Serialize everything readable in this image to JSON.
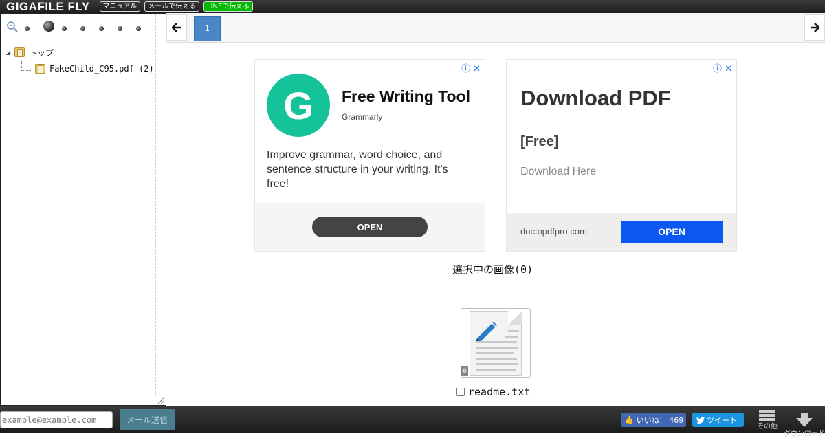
{
  "header": {
    "logo": "GIGAFILE FLY",
    "buttons": [
      "マニュアル",
      "メールで伝える",
      "LINEで伝える"
    ]
  },
  "sidebar": {
    "tree": [
      {
        "label": "トップ"
      },
      {
        "label": "FakeChild_C95.pdf (2)"
      }
    ]
  },
  "pager": {
    "prev": "🡐",
    "current": "1",
    "next": "🡒"
  },
  "ad1": {
    "logo_letter": "G",
    "title": "Free Writing Tool",
    "brand": "Grammarly",
    "body": "Improve grammar, word choice, and sentence structure in your writing. It's free!",
    "cta": "OPEN",
    "close": "ⓘ ✕"
  },
  "ad2": {
    "title": "Download PDF",
    "tag": "[Free]",
    "subtitle": "Download Here",
    "domain": "doctopdfpro.com",
    "cta": "OPEN",
    "close": "ⓘ ✕"
  },
  "selection": {
    "label": "選択中の画像",
    "count": "(0)"
  },
  "file": {
    "index": "0",
    "name": "readme.txt"
  },
  "footer": {
    "email_placeholder": "example@example.com",
    "send_label": "メール送信",
    "like_label": "いいね！ 469",
    "tweet_label": "ツイート",
    "other_label": "その他",
    "download_label": "ダウンロード"
  },
  "colors": {
    "accent": "#4a86c8",
    "grammarly": "#15c39a",
    "ad_open": "#0a58f0",
    "facebook": "#4267b2",
    "twitter": "#1b95e0",
    "line": "#00b900"
  }
}
